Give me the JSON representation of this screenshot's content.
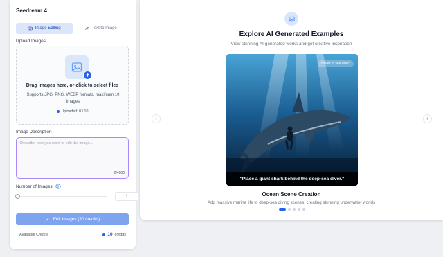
{
  "app": {
    "title": "Seedream 4"
  },
  "tabs": [
    {
      "label": "Image Editing",
      "active": true
    },
    {
      "label": "Text to Image",
      "active": false
    }
  ],
  "upload": {
    "section_label": "Upload Images",
    "main_text": "Drag images here, or click to select files",
    "sub_text": "Supports JPG, PNG, WEBP formats, maximum 10 images",
    "count_text": "Uploaded: 0 / 10"
  },
  "description": {
    "section_label": "Image Description",
    "placeholder": "Describe how you want to edit the image...",
    "counter": "0/4000"
  },
  "num_images": {
    "label": "Number of Images",
    "value": "1"
  },
  "edit_button": {
    "label": "Edit Images  (30 credits)"
  },
  "credits": {
    "label": "Available Credits",
    "value": "10",
    "unit": "credits"
  },
  "gallery": {
    "title": "Explore AI Generated Examples",
    "subtitle": "View stunning AI-generated works and get creative inspiration",
    "hover_hint": "Hover to see effect",
    "caption": "\"Place a giant shark behind the deep-sea diver.\"",
    "scene_title": "Ocean Scene Creation",
    "scene_desc": "Add massive marine life to deep-sea diving scenes, creating stunning underwater worlds",
    "prev_icon": "‹",
    "next_icon": "›",
    "slide_count": 5,
    "active_slide": 0
  },
  "colors": {
    "accent": "#2563eb",
    "button": "#7ea4f0",
    "focus_border": "#a78bfa"
  }
}
